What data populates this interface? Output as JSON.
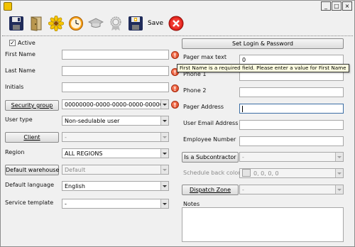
{
  "window": {
    "controls": [
      "_",
      "□",
      "×"
    ]
  },
  "toolbar": {
    "icons": [
      "save-disk-icon",
      "door-icon",
      "flower-icon",
      "clock-icon",
      "graduation-cap-icon",
      "award-icon",
      "save-add-icon"
    ],
    "save_label": "Save",
    "cancel_icon": "cancel-icon"
  },
  "form": {
    "active_label": "Active",
    "active_checked": true,
    "first_name_label": "First Name",
    "first_name_value": "",
    "last_name_label": "Last Name",
    "last_name_value": "",
    "initials_label": "Initials",
    "initials_value": "",
    "security_group_button": "Security group",
    "security_group_value": "00000000-0000-0000-0000-0000000",
    "user_type_label": "User type",
    "user_type_value": "Non-sedulable user",
    "client_button": "Client",
    "client_value": "-",
    "region_label": "Region",
    "region_value": "ALL REGIONS",
    "default_warehouse_button": "Default warehouse",
    "default_warehouse_value": "Default",
    "default_language_label": "Default language",
    "default_language_value": "English",
    "service_template_label": "Service template",
    "service_template_value": "-",
    "set_login_button": "Set Login & Password",
    "pager_max_text_label": "Pager max text",
    "pager_max_text_value": "0",
    "phone1_label": "Phone 1",
    "phone2_label": "Phone 2",
    "pager_address_label": "Pager Address",
    "user_email_label": "User Email Address",
    "employee_number_label": "Employee Number",
    "subcontractor_button": "Is a Subcontractor",
    "subcontractor_value": "-",
    "schedule_back_color_label": "Schedule back color",
    "schedule_back_color_value": "0, 0, 0, 0",
    "dispatch_zone_button": "Dispatch Zone",
    "dispatch_zone_value": "-",
    "notes_label": "Notes"
  },
  "tooltip": {
    "text": "First Name is a required field.  Please enter a value for First Name"
  }
}
